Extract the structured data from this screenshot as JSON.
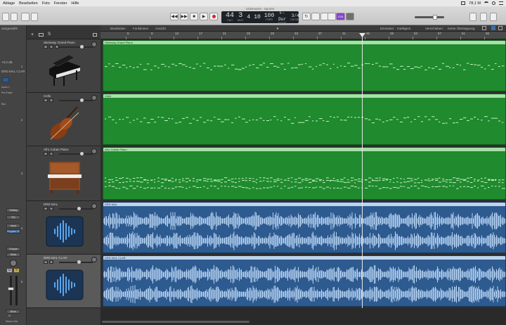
{
  "menubar": {
    "items": [
      "Ablage",
      "Bearbeiten",
      "Foto",
      "Fenster",
      "Hilfe"
    ],
    "battery": "78,1 M"
  },
  "toolbar": {
    "window_title": "Unbenannt - Spuren",
    "lcd": {
      "bar": "44",
      "beat": "3",
      "div": "4",
      "tick": "10",
      "tempo": "100",
      "key": "F-Dur",
      "signature": "3/4",
      "bar_caption": "TAKT",
      "beat_caption": "BEAT",
      "tempo_caption": "TEMPO",
      "key_caption": "TONART",
      "signature_caption": "TAKTART"
    },
    "count_in_label": "1234"
  },
  "inspector": {
    "label_top": "ausgewählt",
    "gain": "+0,0 dB",
    "channel_name": "DRD MAL CLAR",
    "audio_label": "Audio 1",
    "prefader": "Pre-Fader",
    "bus": "Bus",
    "setting_label": "Setting",
    "eq_label": "EQ",
    "input_label": "Input",
    "input_value": "Eingabe 01",
    "group_label": "Gruppe",
    "read_label": "Read",
    "m_label": "M",
    "s_label": "S",
    "bounce_label": "Bnce",
    "channel_footer": "Stereo Out",
    "channel_footer2": "M"
  },
  "header_toolbar": {
    "add_label": "+",
    "s_label": "S"
  },
  "arrange_bar": {
    "edit": "Bearbeiten",
    "functions": "Funktionen",
    "view": "Ansicht",
    "snap_label": "Einrasten:",
    "snap_value": "Intelligent",
    "drag_label": "Verschieben:",
    "drag_value": "Keine Überlappung"
  },
  "ruler": {
    "marks": [
      "5",
      "9",
      "13",
      "17",
      "21",
      "25",
      "29",
      "33",
      "37",
      "41",
      "45",
      "49",
      "53",
      "57",
      "61",
      "65"
    ]
  },
  "tracks": [
    {
      "number": "1",
      "name": "Steinway Grand Piano",
      "region": "Steinway Grand Piano",
      "kind": "midi",
      "icon": "grand-piano-icon"
    },
    {
      "number": "2",
      "name": "Cello",
      "region": "Cello",
      "kind": "midi",
      "icon": "cello-icon"
    },
    {
      "number": "3",
      "name": "Afro Cuban Piano",
      "region": "Afro Cuban Piano",
      "kind": "midi",
      "icon": "upright-piano-icon"
    },
    {
      "number": "4",
      "name": "DRD MAL",
      "region": "DRD MAL",
      "kind": "audio",
      "icon": "waveform-icon"
    },
    {
      "number": "5",
      "name": "DRD MAL CLAR",
      "region": "DRD MAL CLAR",
      "kind": "audio",
      "icon": "waveform-icon"
    }
  ],
  "colors": {
    "midi_region": "#1f8a2e",
    "audio_region": "#2d5a8f",
    "playhead": "#e8e8e8"
  }
}
